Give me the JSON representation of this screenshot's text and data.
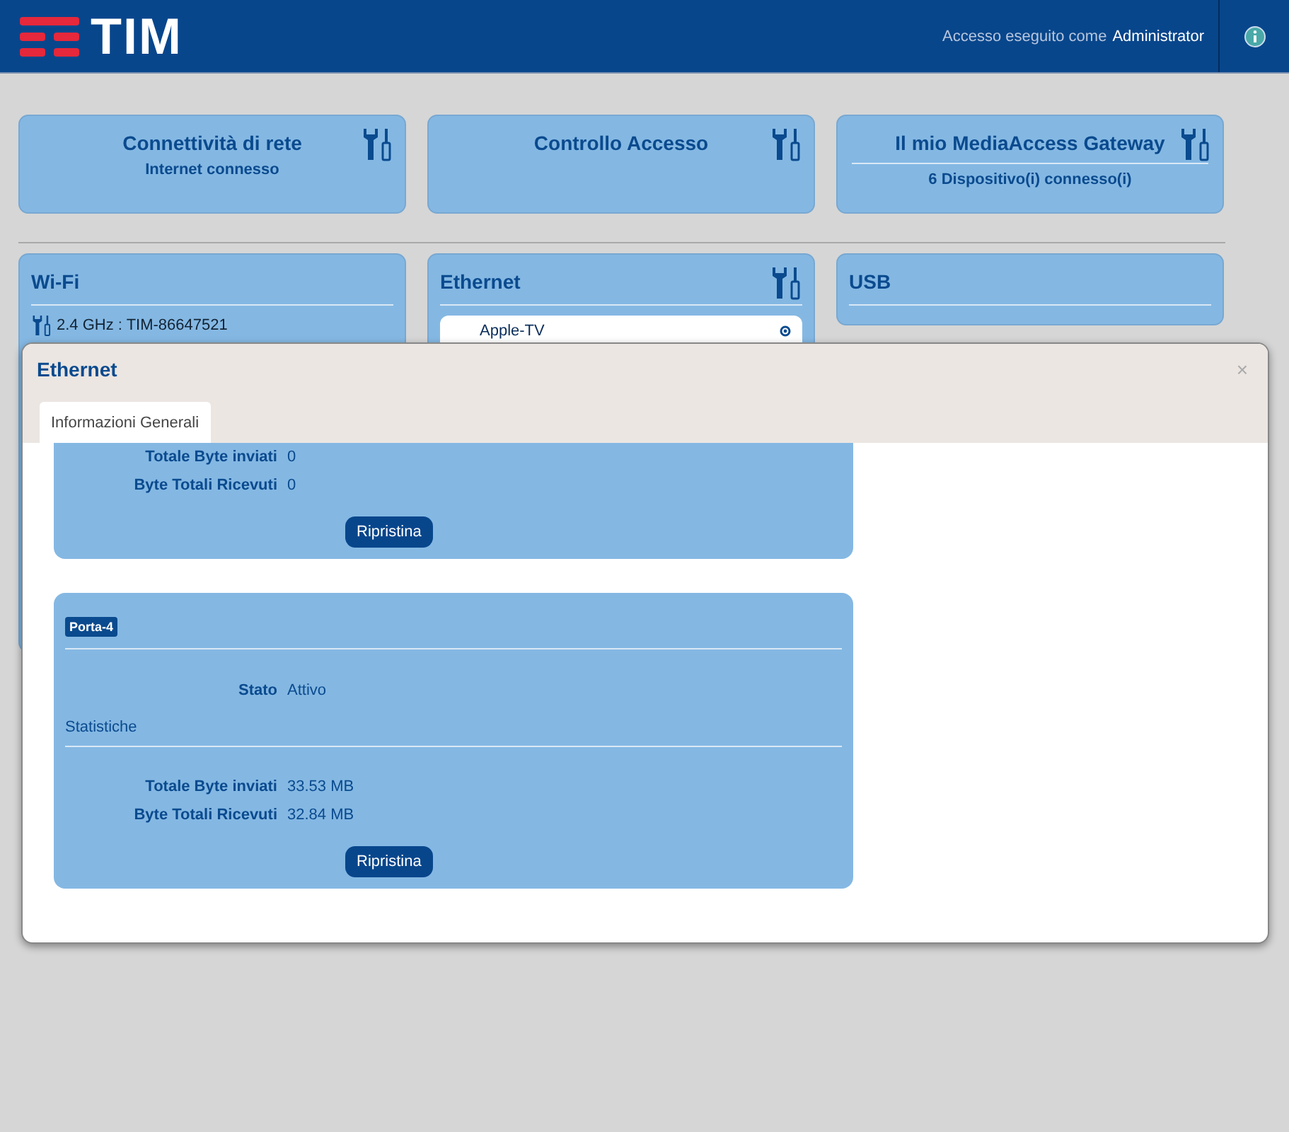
{
  "header": {
    "logo": "TIM",
    "login_label": "Accesso eseguito come",
    "user": "Administrator"
  },
  "tiles": [
    {
      "title": "Connettività di rete",
      "subtitle": "Internet connesso",
      "tools": true,
      "divider": false
    },
    {
      "title": "Controllo Accesso",
      "tools": true,
      "divider": false
    },
    {
      "title": "Il mio MediaAccess Gateway",
      "subtitle": "6 Dispositivo(i) connesso(i)",
      "tools": true,
      "divider": true
    }
  ],
  "panels": [
    {
      "title": "Wi-Fi",
      "tools": false,
      "kind": "wifi",
      "line": "2.4 GHz : TIM-86647521"
    },
    {
      "title": "Ethernet",
      "tools": true,
      "kind": "list",
      "items": [
        "Apple-TV"
      ]
    },
    {
      "title": "USB",
      "tools": false,
      "kind": "empty"
    }
  ],
  "modal": {
    "title": "Ethernet",
    "close": "×",
    "tabs": [
      {
        "label": "Informazioni Generali",
        "selected": true
      }
    ],
    "ports": [
      {
        "rows": [
          {
            "label": "Totale Byte inviati",
            "value": "0"
          },
          {
            "label": "Byte Totali Ricevuti",
            "value": "0"
          }
        ],
        "button": "Ripristina"
      },
      {
        "badge": "Porta-4",
        "state_label": "Stato",
        "state_value": "Attivo",
        "section": "Statistiche",
        "rows": [
          {
            "label": "Totale Byte inviati",
            "value": "33.53 MB"
          },
          {
            "label": "Byte Totali Ricevuti",
            "value": "32.84 MB"
          }
        ],
        "button": "Ripristina"
      }
    ]
  }
}
